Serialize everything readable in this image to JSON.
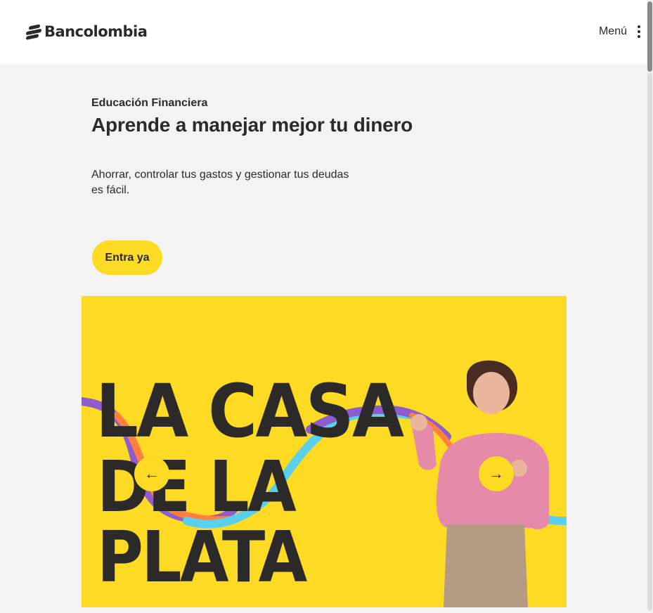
{
  "header": {
    "brand": "Bancolombia",
    "menu_label": "Menú"
  },
  "hero": {
    "eyebrow": "Educación Financiera",
    "title": "Aprende a manejar mejor tu dinero",
    "description": "Ahorrar, controlar tus gastos y gestionar tus deudas es fácil.",
    "cta_label": "Entra ya"
  },
  "banner": {
    "headline_line1": "LA CASA",
    "headline_line2": "DE LA PLATA",
    "prev_icon": "arrow-left-icon",
    "next_icon": "arrow-right-icon",
    "background_color": "#fdda24"
  },
  "colors": {
    "brand_yellow": "#fdda24",
    "text_dark": "#2c2a29",
    "page_bg": "#f4f4f4"
  }
}
